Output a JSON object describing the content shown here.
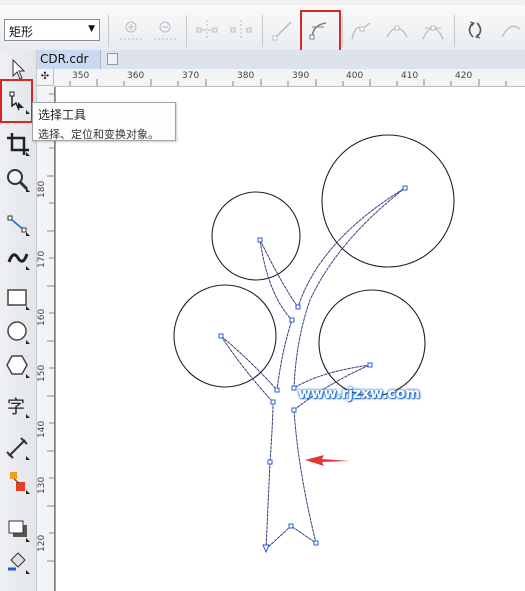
{
  "toolbar": {
    "shape_dropdown": {
      "value": "矩形"
    },
    "buttons": [
      "add-node",
      "delete-node",
      "join-nodes",
      "break-curve",
      "to-line",
      "to-curve",
      "cusp-node",
      "smooth-node",
      "symmetrical-node",
      "reverse-direction"
    ]
  },
  "document": {
    "tab_label": "CDR.cdr"
  },
  "rulers": {
    "horizontal_ticks": [
      "350",
      "360",
      "370",
      "380",
      "390",
      "400",
      "410",
      "420"
    ],
    "vertical_ticks": [
      "180",
      "170",
      "160",
      "150",
      "140",
      "130",
      "120"
    ]
  },
  "tooltip": {
    "title": "选择工具",
    "description": "选择、定位和变换对象。"
  },
  "tools": [
    "pick-tool",
    "shape-tool",
    "crop-tool",
    "zoom-tool",
    "freehand-tool",
    "artistic-media-tool",
    "rectangle-tool",
    "ellipse-tool",
    "polygon-tool",
    "text-tool",
    "dimension-tool",
    "interactive-tool",
    "shadow-tool",
    "fill-tool"
  ],
  "canvas": {
    "watermark": "www.rjzxw.com"
  },
  "colors": {
    "highlight": "#e02424",
    "arrow": "#e53535",
    "node": "#2a5bd7"
  }
}
